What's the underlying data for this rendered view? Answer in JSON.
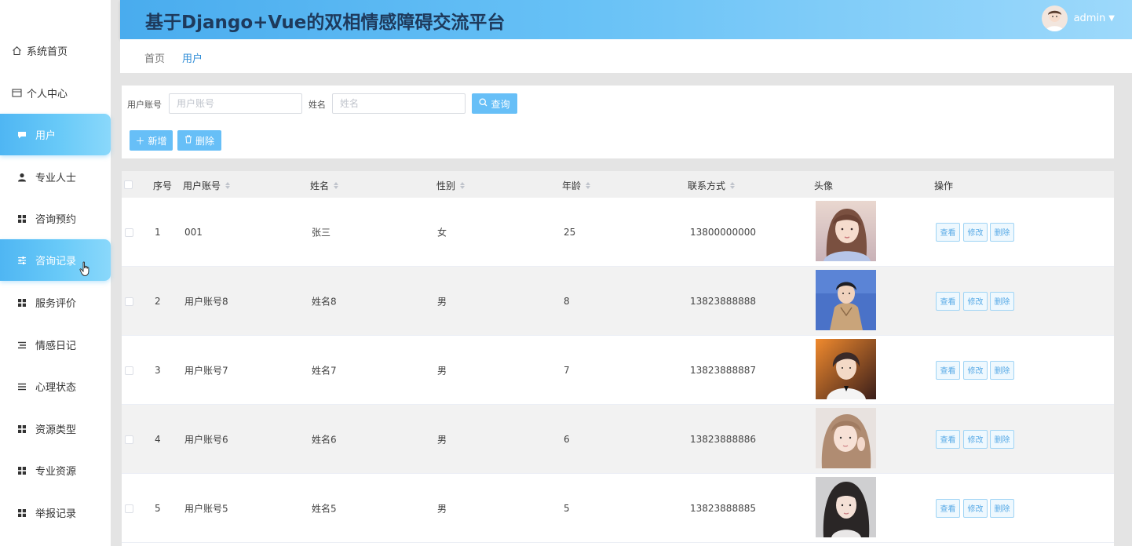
{
  "header": {
    "title": "基于Django+Vue的双相情感障碍交流平台",
    "username": "admin"
  },
  "sidebar": {
    "items": [
      {
        "label": "系统首页",
        "icon": "home-icon"
      },
      {
        "label": "个人中心",
        "icon": "card-icon"
      },
      {
        "label": "用户",
        "icon": "chat-icon",
        "active": true
      },
      {
        "label": "专业人士",
        "icon": "person-icon"
      },
      {
        "label": "咨询预约",
        "icon": "grid-icon"
      },
      {
        "label": "咨询记录",
        "icon": "sliders-icon",
        "active": true
      },
      {
        "label": "服务评价",
        "icon": "grid-icon"
      },
      {
        "label": "情感日记",
        "icon": "list-icon"
      },
      {
        "label": "心理状态",
        "icon": "menu-icon"
      },
      {
        "label": "资源类型",
        "icon": "grid-icon"
      },
      {
        "label": "专业资源",
        "icon": "grid-icon"
      },
      {
        "label": "举报记录",
        "icon": "grid-icon"
      }
    ]
  },
  "breadcrumb": {
    "home": "首页",
    "current": "用户"
  },
  "search": {
    "account_label": "用户账号",
    "account_placeholder": "用户账号",
    "name_label": "姓名",
    "name_placeholder": "姓名",
    "query_label": "查询"
  },
  "actions": {
    "add_label": "新增",
    "delete_label": "删除"
  },
  "table": {
    "headers": {
      "index": "序号",
      "account": "用户账号",
      "name": "姓名",
      "gender": "性别",
      "age": "年龄",
      "phone": "联系方式",
      "avatar": "头像",
      "ops": "操作"
    },
    "op_labels": {
      "view": "查看",
      "edit": "修改",
      "delete": "删除"
    },
    "rows": [
      {
        "index": "1",
        "account": "001",
        "name": "张三",
        "gender": "女",
        "age": "25",
        "phone": "13800000000"
      },
      {
        "index": "2",
        "account": "用户账号8",
        "name": "姓名8",
        "gender": "男",
        "age": "8",
        "phone": "13823888888"
      },
      {
        "index": "3",
        "account": "用户账号7",
        "name": "姓名7",
        "gender": "男",
        "age": "7",
        "phone": "13823888887"
      },
      {
        "index": "4",
        "account": "用户账号6",
        "name": "姓名6",
        "gender": "男",
        "age": "6",
        "phone": "13823888886"
      },
      {
        "index": "5",
        "account": "用户账号5",
        "name": "姓名5",
        "gender": "男",
        "age": "5",
        "phone": "13823888885"
      }
    ]
  },
  "colors": {
    "accent": "#67bff7",
    "active_nav": "#4fb6f3",
    "title": "#1e3a5c"
  }
}
